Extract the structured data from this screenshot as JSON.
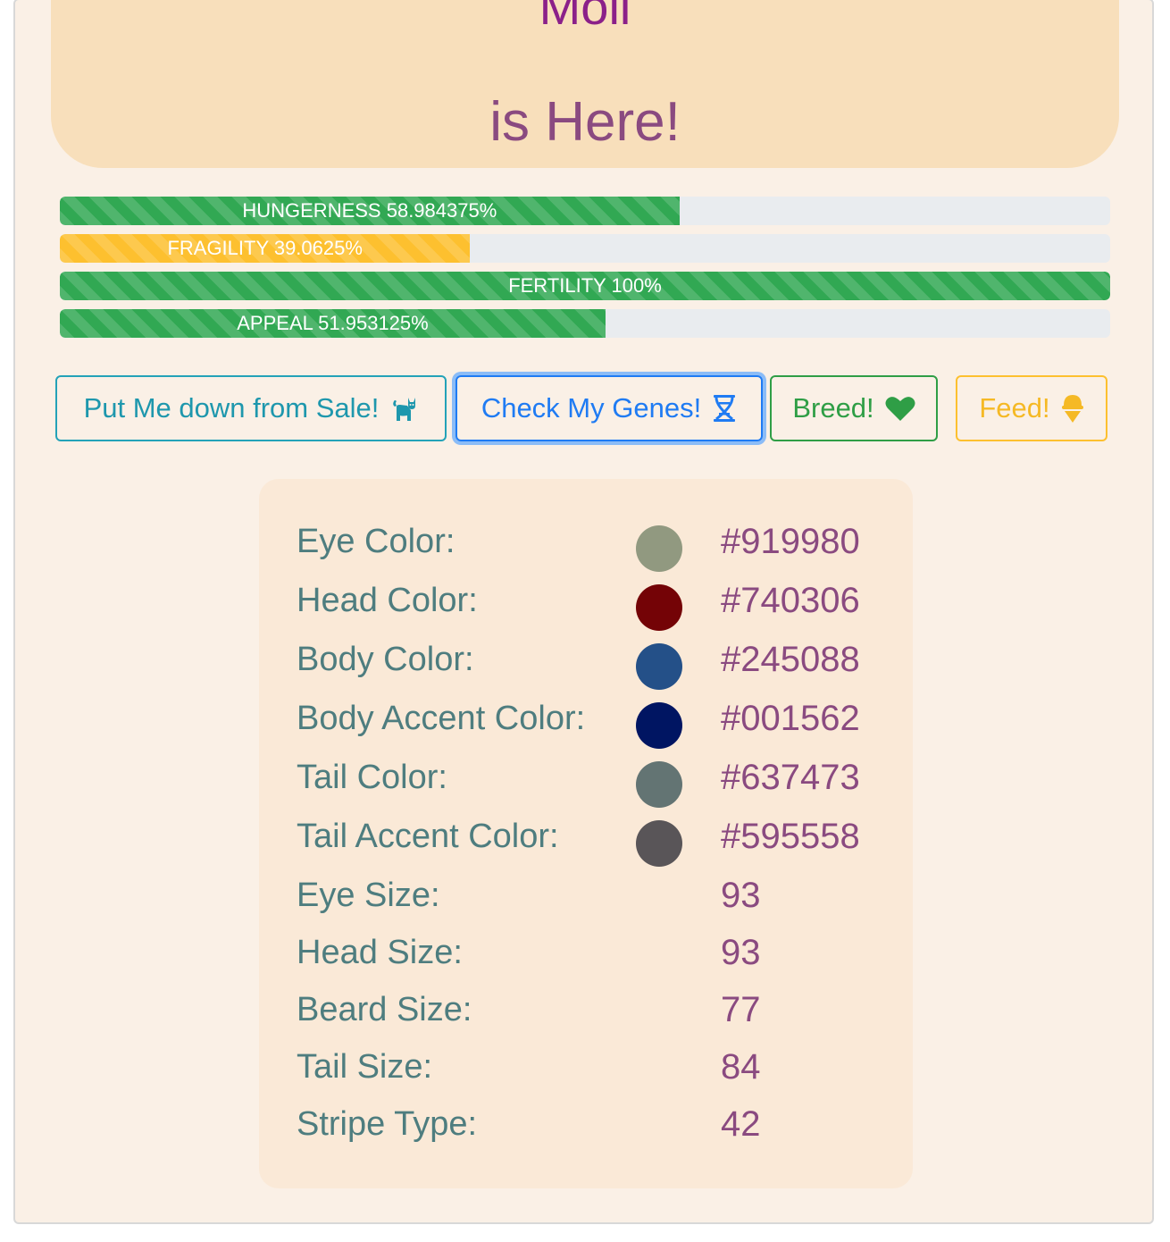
{
  "hero": {
    "name": "Moli",
    "subtitle": "is Here!"
  },
  "stats": [
    {
      "label": "HUNGERNESS 58.984375%",
      "percent": 58.984375,
      "color": "green"
    },
    {
      "label": "FRAGILITY 39.0625%",
      "percent": 39.0625,
      "color": "yellow"
    },
    {
      "label": "FERTILITY 100%",
      "percent": 100,
      "color": "green"
    },
    {
      "label": "APPEAL 51.953125%",
      "percent": 51.953125,
      "color": "green"
    }
  ],
  "actions": {
    "sale": {
      "label": "Put Me down from Sale!",
      "icon": "cat-icon"
    },
    "genes": {
      "label": "Check My Genes!",
      "icon": "dna-icon"
    },
    "breed": {
      "label": "Breed!",
      "icon": "heart-icon"
    },
    "feed": {
      "label": "Feed!",
      "icon": "ice-cream-icon"
    }
  },
  "genes": [
    {
      "label": "Eye Color:",
      "value": "#919980",
      "swatch": "#919980"
    },
    {
      "label": "Head Color:",
      "value": "#740306",
      "swatch": "#740306"
    },
    {
      "label": "Body Color:",
      "value": "#245088",
      "swatch": "#245088"
    },
    {
      "label": "Body Accent Color:",
      "value": "#001562",
      "swatch": "#001562"
    },
    {
      "label": "Tail Color:",
      "value": "#637473",
      "swatch": "#637473"
    },
    {
      "label": "Tail Accent Color:",
      "value": "#595558",
      "swatch": "#595558"
    },
    {
      "label": "Eye Size:",
      "value": "93"
    },
    {
      "label": "Head Size:",
      "value": "93"
    },
    {
      "label": "Beard Size:",
      "value": "77"
    },
    {
      "label": "Tail Size:",
      "value": "84"
    },
    {
      "label": "Stripe Type:",
      "value": "42"
    }
  ]
}
